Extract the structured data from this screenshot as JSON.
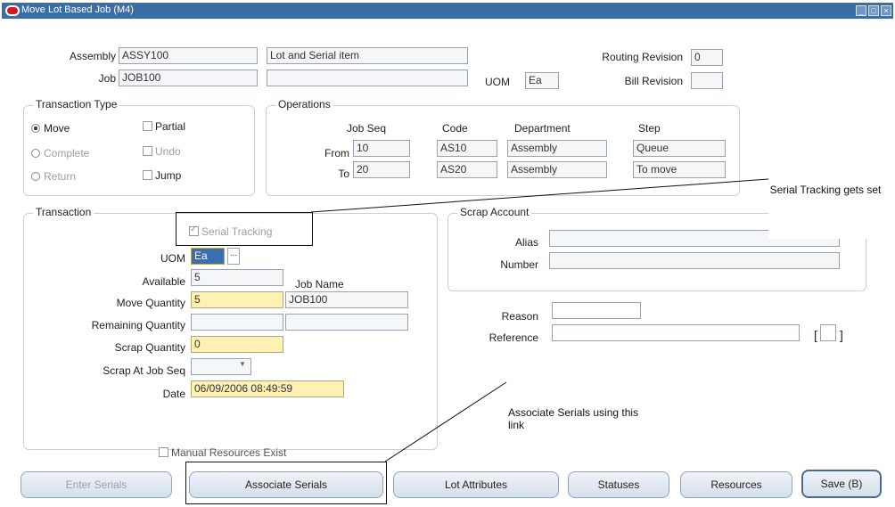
{
  "window": {
    "title": "Move Lot Based Job (M4)"
  },
  "header": {
    "assembly_label": "Assembly",
    "assembly_value": "ASSY100",
    "assembly_desc": "Lot and Serial item",
    "job_label": "Job",
    "job_value": "JOB100",
    "uom_label": "UOM",
    "uom_value": "Ea",
    "routing_rev_label": "Routing Revision",
    "routing_rev_value": "0",
    "bill_rev_label": "Bill Revision",
    "bill_rev_value": ""
  },
  "transaction_type": {
    "title": "Transaction Type",
    "move": "Move",
    "complete": "Complete",
    "return": "Return",
    "partial": "Partial",
    "undo": "Undo",
    "jump": "Jump"
  },
  "operations": {
    "title": "Operations",
    "col_job_seq": "Job Seq",
    "col_code": "Code",
    "col_department": "Department",
    "col_step": "Step",
    "from_label": "From",
    "to_label": "To",
    "from": {
      "job_seq": "10",
      "code": "AS10",
      "department": "Assembly",
      "step": "Queue"
    },
    "to": {
      "job_seq": "20",
      "code": "AS20",
      "department": "Assembly",
      "step": "To move"
    }
  },
  "transaction": {
    "title": "Transaction",
    "serial_tracking": "Serial Tracking",
    "uom_label": "UOM",
    "uom_value": "Ea",
    "uom_lov": "...",
    "available_label": "Available",
    "available_value": "5",
    "job_name_label": "Job Name",
    "move_qty_label": "Move Quantity",
    "move_qty_value": "5",
    "job_name_value": "JOB100",
    "remaining_qty_label": "Remaining Quantity",
    "remaining_qty_value": "",
    "scrap_qty_label": "Scrap Quantity",
    "scrap_qty_value": "0",
    "scrap_at_label": "Scrap At Job Seq",
    "scrap_at_value": "",
    "date_label": "Date",
    "date_value": "06/09/2006 08:49:59"
  },
  "scrap_account": {
    "title": "Scrap Account",
    "alias_label": "Alias",
    "alias_value": "",
    "number_label": "Number",
    "number_value": ""
  },
  "reason_label": "Reason",
  "reason_value": "",
  "reference_label": "Reference",
  "reference_value": "",
  "manual_resources": "Manual Resources Exist",
  "buttons": {
    "enter_serials": "Enter Serials",
    "associate_serials": "Associate Serials",
    "lot_attributes": "Lot Attributes",
    "statuses": "Statuses",
    "resources": "Resources",
    "save": "Save (B)"
  },
  "callouts": {
    "serial_tracking": "Serial Tracking gets set",
    "associate": "Associate Serials using this link"
  },
  "colors": {
    "titlebar": "#3a6ea5",
    "required_field": "#fdf1b3"
  }
}
